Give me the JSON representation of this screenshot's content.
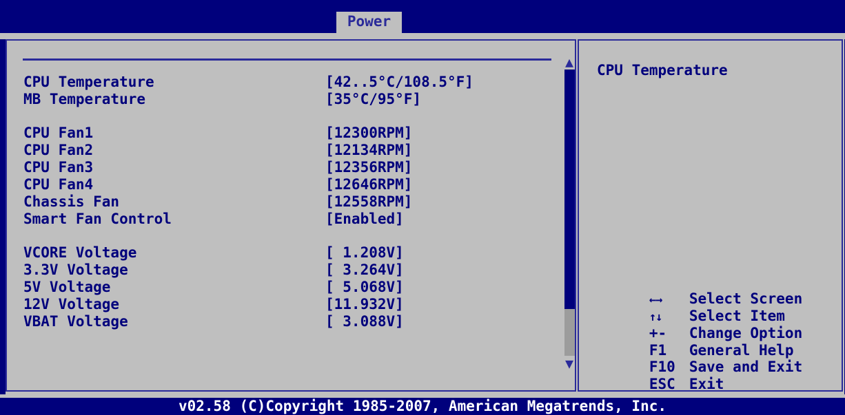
{
  "tabs": {
    "active": "Power"
  },
  "sensors": [
    {
      "label": "CPU Temperature",
      "value": "[42..5°C/108.5°F]"
    },
    {
      "label": "MB Temperature",
      "value": "[35°C/95°F]"
    },
    {
      "label": "CPU Fan1",
      "value": "[12300RPM]"
    },
    {
      "label": "CPU Fan2",
      "value": "[12134RPM]"
    },
    {
      "label": "CPU Fan3",
      "value": "[12356RPM]"
    },
    {
      "label": "CPU Fan4",
      "value": "[12646RPM]"
    },
    {
      "label": "Chassis Fan",
      "value": "[12558RPM]"
    },
    {
      "label": "Smart Fan Control",
      "value": "[Enabled]"
    },
    {
      "label": "VCORE Voltage",
      "value": "[ 1.208V]"
    },
    {
      "label": "3.3V Voltage",
      "value": "[ 3.264V]"
    },
    {
      "label": "5V Voltage",
      "value": "[ 5.068V]"
    },
    {
      "label": "12V Voltage",
      "value": "[11.932V]"
    },
    {
      "label": "VBAT Voltage",
      "value": "[ 3.088V]"
    }
  ],
  "help": {
    "title": "CPU Temperature",
    "keys": [
      {
        "key": "←→",
        "icon": "left-right-arrows-icon",
        "desc": "Select Screen"
      },
      {
        "key": "↑↓",
        "icon": "up-down-arrows-icon",
        "desc": "Select Item"
      },
      {
        "key": "+-",
        "desc": "Change Option"
      },
      {
        "key": "F1",
        "desc": "General Help"
      },
      {
        "key": "F10",
        "desc": "Save and Exit"
      },
      {
        "key": "ESC",
        "desc": "Exit"
      }
    ]
  },
  "scrollbar": {
    "up_icon": "▲",
    "down_icon": "▼"
  },
  "footer": {
    "text": "v02.58 (C)Copyright 1985-2007, American Megatrends, Inc."
  },
  "colors": {
    "background": "#00007c",
    "panel": "#bfbfbf",
    "text": "#00007c",
    "border": "#2a2a9a"
  }
}
